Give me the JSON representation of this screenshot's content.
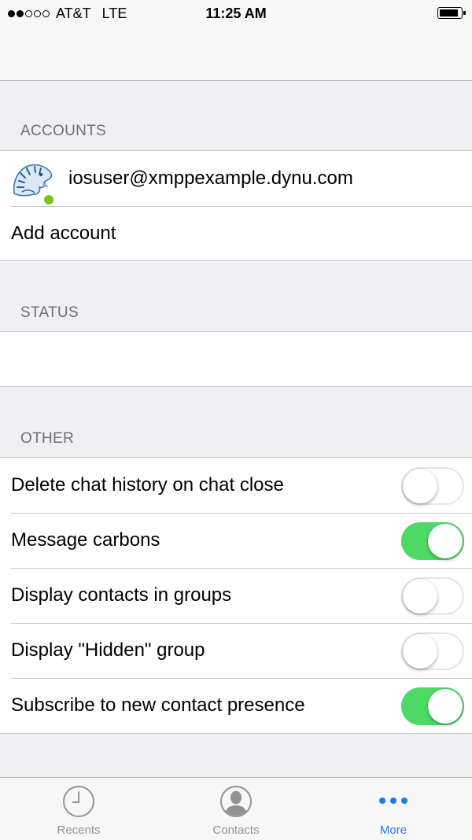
{
  "status_bar": {
    "carrier": "AT&T",
    "network": "LTE",
    "time": "11:25 AM"
  },
  "sections": {
    "accounts": {
      "header": "ACCOUNTS",
      "account_jid": "iosuser@xmppexample.dynu.com",
      "account_status": "online",
      "add_account": "Add account"
    },
    "status": {
      "header": "STATUS"
    },
    "other": {
      "header": "OTHER",
      "settings": [
        {
          "label": "Delete chat history on chat close",
          "enabled": false
        },
        {
          "label": "Message carbons",
          "enabled": true
        },
        {
          "label": "Display contacts in groups",
          "enabled": false
        },
        {
          "label": "Display \"Hidden\" group",
          "enabled": false
        },
        {
          "label": "Subscribe to new contact presence",
          "enabled": true
        }
      ]
    }
  },
  "tabs": [
    {
      "label": "Recents",
      "icon": "clock-icon",
      "active": false
    },
    {
      "label": "Contacts",
      "icon": "person-icon",
      "active": false
    },
    {
      "label": "More",
      "icon": "more-dots-icon",
      "active": true
    }
  ],
  "colors": {
    "background": "#efeff4",
    "toggle_on": "#4cd964",
    "online": "#7ac51a",
    "tab_active": "#1a7cf5",
    "tab_inactive": "#929292"
  }
}
